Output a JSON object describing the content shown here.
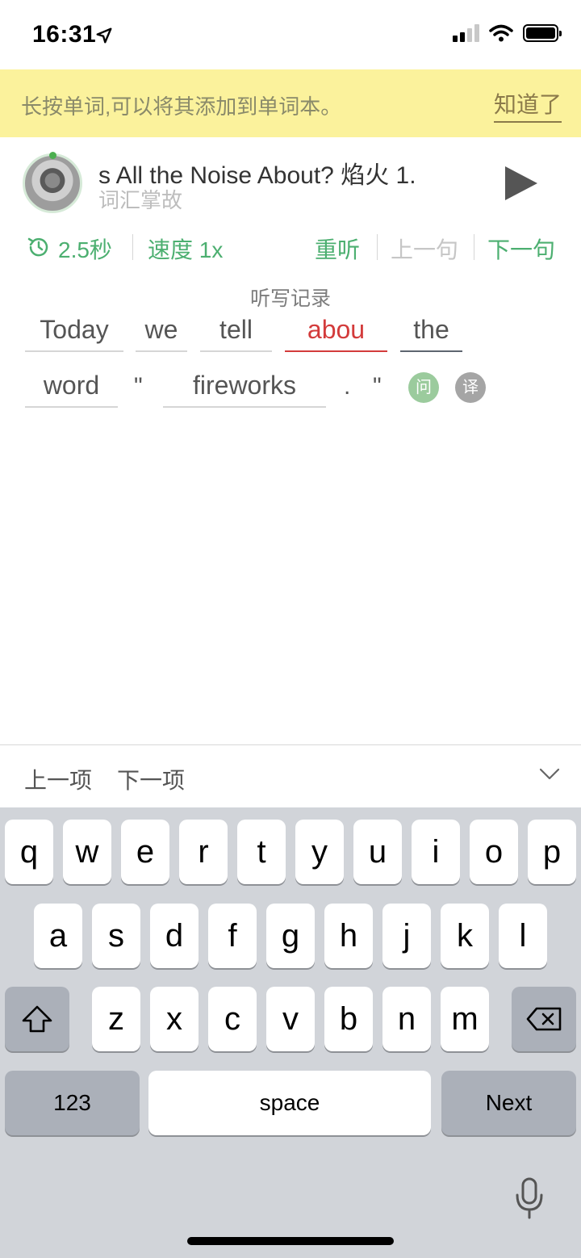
{
  "status_bar": {
    "time": "16:31"
  },
  "tip": {
    "text": "长按单词,可以将其添加到单词本。",
    "dismiss_label": "知道了"
  },
  "track": {
    "title": "s All the Noise About? 焰火     1.",
    "subtitle": "词汇掌故"
  },
  "controls": {
    "interval": "2.5秒",
    "speed": "速度 1x",
    "replay": "重听",
    "prev_sentence": "上一句",
    "next_sentence": "下一句"
  },
  "dictation": {
    "section_label": "听写记录",
    "words": [
      {
        "text": "Today",
        "state": "normal"
      },
      {
        "text": "we",
        "state": "normal"
      },
      {
        "text": "tell",
        "state": "normal"
      },
      {
        "text": "abou",
        "state": "error"
      },
      {
        "text": "the",
        "state": "current"
      },
      {
        "text": "word",
        "state": "normal"
      },
      {
        "text": "\"",
        "state": "punct"
      },
      {
        "text": "fireworks",
        "state": "normal"
      },
      {
        "text": ".",
        "state": "punct"
      },
      {
        "text": "\"",
        "state": "punct"
      }
    ],
    "ask_label": "问",
    "translate_label": "译"
  },
  "toolbar": {
    "prev_item": "上一项",
    "next_item": "下一项"
  },
  "keyboard": {
    "row1": [
      "q",
      "w",
      "e",
      "r",
      "t",
      "y",
      "u",
      "i",
      "o",
      "p"
    ],
    "row2": [
      "a",
      "s",
      "d",
      "f",
      "g",
      "h",
      "j",
      "k",
      "l"
    ],
    "row3": [
      "z",
      "x",
      "c",
      "v",
      "b",
      "n",
      "m"
    ],
    "numbers_label": "123",
    "space_label": "space",
    "return_label": "Next"
  }
}
